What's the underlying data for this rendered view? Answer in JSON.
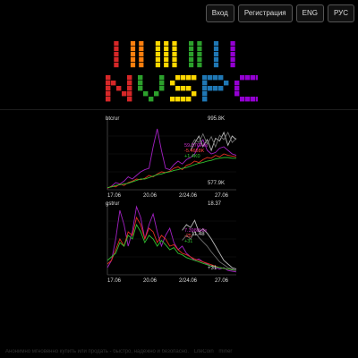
{
  "header": {
    "buttons": [
      {
        "name": "login-button",
        "label": "Вход"
      },
      {
        "name": "register-button",
        "label": "Регистрация"
      },
      {
        "name": "lang-eng-button",
        "label": "ENG"
      },
      {
        "name": "lang-rus-button",
        "label": "РУС"
      }
    ]
  },
  "logo": {
    "text": "NVSPC",
    "colors": {
      "bars": [
        "#d62728",
        "#ff7f0e",
        "#ffd700",
        "#2ca02c",
        "#1f77b4",
        "#9400d3"
      ],
      "letters": [
        "#d62728",
        "#2ca02c",
        "#ffd700",
        "#1f77b4",
        "#9400d3"
      ]
    }
  },
  "chart_data": [
    {
      "type": "line",
      "title": "btcrur",
      "x_ticks": [
        "17.06",
        "20.06",
        "2/24.06",
        "27.06"
      ],
      "y_top_label": "995.8K",
      "y_bottom_label": "577.9K",
      "current_labels": [
        {
          "text": "59.37GH/s",
          "color": "#cc33cc"
        },
        {
          "text": "-5.4658K",
          "color": "#ff4040"
        },
        {
          "text": "+1.4K0",
          "color": "#33cc33"
        }
      ],
      "series": [
        {
          "color": "#a020c0",
          "values": [
            0.02,
            0.05,
            0.1,
            0.08,
            0.12,
            0.18,
            0.15,
            0.2,
            0.25,
            0.28,
            0.3,
            0.6,
            0.85,
            0.55,
            0.3,
            0.28,
            0.35,
            0.4,
            0.36,
            0.42,
            0.45,
            0.5,
            0.62,
            0.7,
            0.55,
            0.5,
            0.52,
            0.58,
            0.6,
            0.55,
            0.5,
            0.48
          ]
        },
        {
          "color": "#e03020",
          "values": [
            0.02,
            0.05,
            0.04,
            0.08,
            0.06,
            0.1,
            0.12,
            0.15,
            0.14,
            0.16,
            0.2,
            0.18,
            0.22,
            0.25,
            0.24,
            0.26,
            0.3,
            0.32,
            0.28,
            0.34,
            0.36,
            0.4,
            0.38,
            0.42,
            0.45,
            0.44,
            0.48,
            0.46,
            0.5,
            0.48,
            0.47,
            0.46
          ]
        },
        {
          "color": "#30c030",
          "values": [
            0.03,
            0.04,
            0.06,
            0.07,
            0.08,
            0.09,
            0.11,
            0.13,
            0.15,
            0.15,
            0.17,
            0.19,
            0.21,
            0.22,
            0.24,
            0.25,
            0.27,
            0.28,
            0.3,
            0.31,
            0.33,
            0.35,
            0.37,
            0.38,
            0.4,
            0.41,
            0.43,
            0.44,
            0.45,
            0.45,
            0.44,
            0.44
          ]
        },
        {
          "color": "#b8b8b8",
          "values": [
            null,
            null,
            null,
            null,
            null,
            null,
            null,
            null,
            null,
            null,
            null,
            null,
            null,
            null,
            null,
            null,
            null,
            null,
            null,
            null,
            0.55,
            0.65,
            0.75,
            0.6,
            0.7,
            0.55,
            0.72,
            0.68,
            0.8,
            0.62,
            0.75,
            0.7
          ]
        },
        {
          "color": "#707070",
          "values": [
            null,
            null,
            null,
            null,
            null,
            null,
            null,
            null,
            null,
            null,
            null,
            null,
            null,
            null,
            null,
            null,
            null,
            null,
            null,
            null,
            0.6,
            0.7,
            0.66,
            0.78,
            0.64,
            0.74,
            0.6,
            0.76,
            0.7,
            0.8,
            0.66,
            0.72
          ]
        }
      ]
    },
    {
      "type": "line",
      "title": "gstrur",
      "x_ticks": [
        "17.06",
        "20.06",
        "2/24.06",
        "27.06"
      ],
      "y_top_label": "18.37",
      "y_mid_label": "11.48",
      "y_bottom_label": "+31",
      "current_labels": [
        {
          "text": "7.3980H/s",
          "color": "#cc33cc"
        },
        {
          "text": "-25",
          "color": "#ff4040"
        },
        {
          "text": "+31",
          "color": "#33cc33"
        }
      ],
      "series": [
        {
          "color": "#a020c0",
          "values": [
            0.1,
            0.2,
            0.5,
            0.9,
            0.7,
            0.4,
            0.6,
            0.95,
            0.8,
            0.5,
            0.7,
            0.85,
            0.6,
            0.4,
            0.55,
            0.65,
            0.45,
            0.35,
            0.4,
            0.3,
            0.25,
            0.2,
            0.22,
            0.18,
            0.15,
            0.12,
            0.1,
            0.08,
            0.1,
            0.06,
            0.05,
            0.04
          ]
        },
        {
          "color": "#e03020",
          "values": [
            0.15,
            0.2,
            0.35,
            0.5,
            0.4,
            0.6,
            0.55,
            0.8,
            0.7,
            0.5,
            0.65,
            0.6,
            0.45,
            0.55,
            0.5,
            0.4,
            0.42,
            0.35,
            0.3,
            0.28,
            0.25,
            0.22,
            0.2,
            0.18,
            0.16,
            0.14,
            0.12,
            0.1,
            0.09,
            0.08,
            0.07,
            0.06
          ]
        },
        {
          "color": "#30c030",
          "values": [
            0.2,
            0.25,
            0.3,
            0.45,
            0.4,
            0.55,
            0.5,
            0.7,
            0.6,
            0.45,
            0.55,
            0.5,
            0.4,
            0.48,
            0.42,
            0.35,
            0.38,
            0.3,
            0.28,
            0.24,
            0.22,
            0.2,
            0.18,
            0.16,
            0.14,
            0.12,
            0.11,
            0.1,
            0.09,
            0.08,
            0.07,
            0.06
          ]
        },
        {
          "color": "#b8b8b8",
          "values": [
            null,
            null,
            null,
            null,
            null,
            null,
            null,
            null,
            null,
            null,
            null,
            null,
            null,
            null,
            null,
            null,
            null,
            null,
            0.62,
            0.7,
            0.66,
            0.76,
            0.6,
            0.64,
            0.58,
            0.5,
            0.4,
            0.3,
            0.2,
            0.15,
            0.1,
            0.08
          ]
        },
        {
          "color": "#707070",
          "values": [
            null,
            null,
            null,
            null,
            null,
            null,
            null,
            null,
            null,
            null,
            null,
            null,
            null,
            null,
            null,
            null,
            null,
            null,
            0.48,
            0.55,
            0.5,
            0.6,
            0.52,
            0.46,
            0.4,
            0.32,
            0.25,
            0.18,
            0.14,
            0.1,
            0.08,
            0.06
          ]
        }
      ]
    }
  ],
  "footer": {
    "text": "Анонимно мгновенно купить или продать - быстро, надёжно и безопасно.",
    "links": [
      "LiteCoin",
      "miner"
    ]
  }
}
